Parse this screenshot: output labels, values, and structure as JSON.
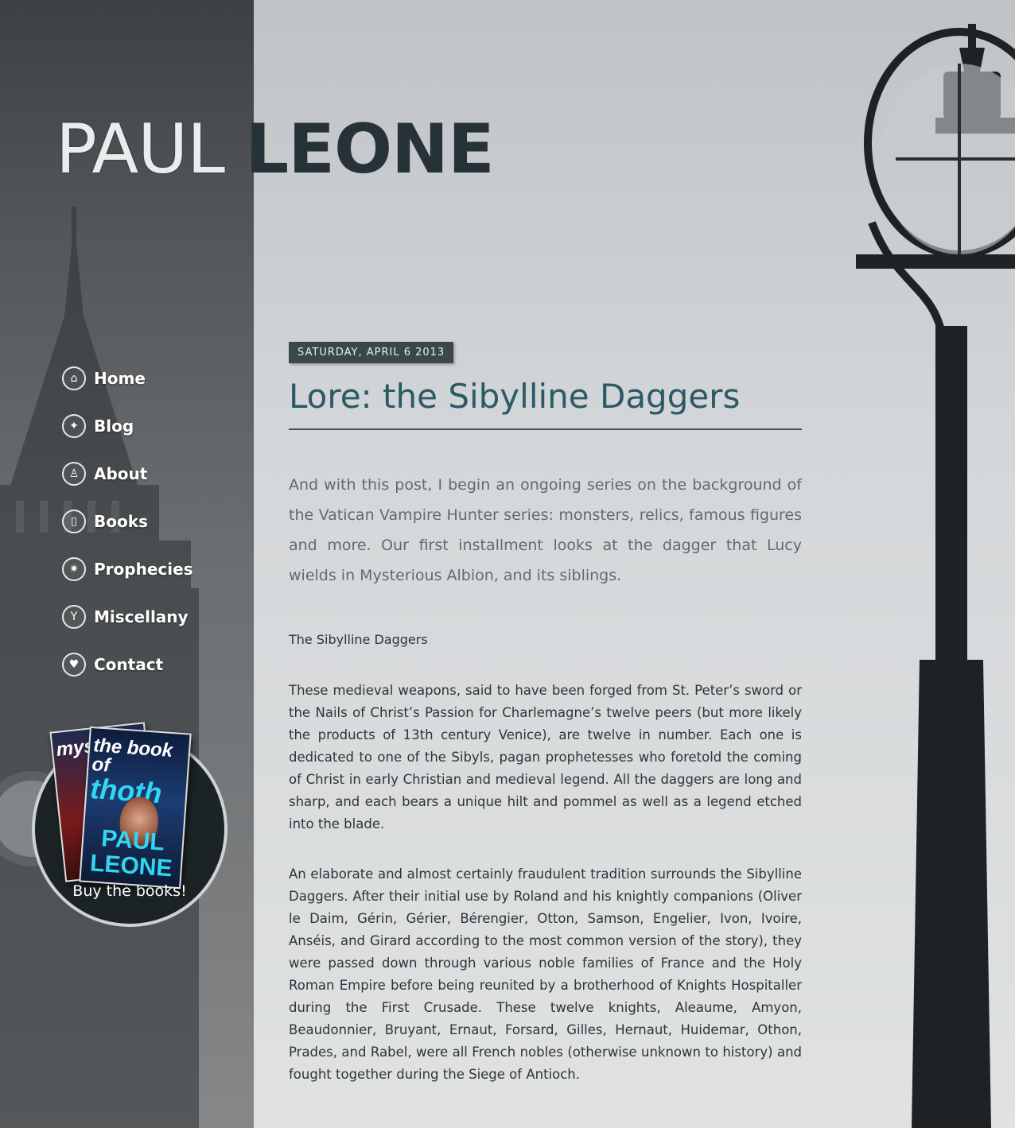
{
  "site": {
    "first_name": "PAUL",
    "last_name": "LEONE"
  },
  "nav": {
    "items": [
      {
        "label": "Home",
        "icon": "house-icon"
      },
      {
        "label": "Blog",
        "icon": "twitter-bird-icon"
      },
      {
        "label": "About",
        "icon": "person-icon"
      },
      {
        "label": "Books",
        "icon": "book-icon"
      },
      {
        "label": "Prophecies",
        "icon": "star-icon"
      },
      {
        "label": "Miscellany",
        "icon": "wine-glass-icon"
      },
      {
        "label": "Contact",
        "icon": "heart-icon"
      }
    ]
  },
  "promo": {
    "label": "Buy the books!",
    "front_book": {
      "title_line1": "the book of",
      "title_line2": "thoth",
      "author": "PAUL LEONE"
    },
    "back_book": {
      "title": "mys"
    }
  },
  "post": {
    "date": "SATURDAY, APRIL 6 2013",
    "title": "Lore: the Sibylline Daggers",
    "intro": "And with this post, I begin an ongoing series on the background of the Vatican Vampire Hunter series: monsters, relics, famous figures and more. Our first installment looks at the dagger that Lucy wields in Mysterious Albion, and its siblings.",
    "subheading": "The Sibylline Daggers",
    "paragraphs": [
      "These medieval weapons, said to have been forged from St. Peter’s sword or the Nails of Christ’s Passion for Charlemagne’s twelve peers (but more likely the products of 13th century Venice), are twelve in number. Each one is dedicated to one of the Sibyls, pagan prophetesses who foretold the coming of Christ in early Christian and medieval legend. All the daggers are long and sharp, and each bears a unique hilt and pommel as well as a legend etched into the blade.",
      "An elaborate and almost certainly fraudulent tradition surrounds the Sibylline Daggers. After their initial use by Roland and his knightly companions (Oliver le Daim, Gérin, Gérier, Bérengier, Otton, Samson, Engelier, Ivon, Ivoire, Anséis, and Girard according to the most common version of the story), they were passed down through various noble families of France and the Holy Roman Empire before being reunited by a brotherhood of Knights Hospitaller during the First Crusade. These twelve knights, Aleaume, Amyon, Beaudonnier, Bruyant, Ernaut, Forsard, Gilles, Hernaut, Huidemar, Othon, Prades, and Rabel, were all French nobles (otherwise unknown to history) and fought together during the Siege of Antioch."
    ]
  }
}
